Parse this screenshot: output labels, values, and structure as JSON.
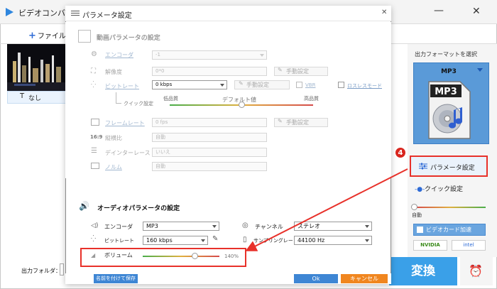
{
  "main": {
    "app_title": "ビデオコンバ",
    "add_file_label": "ファイル追",
    "subtitle_label": "なし",
    "output_folder_label": "出力フォルダ：",
    "convert_label": "変換"
  },
  "right_panel": {
    "output_format_label": "出力フォーマットを選択",
    "format_name": "MP3",
    "format_icon_text": "MP3",
    "param_settings_label": "パラメータ設定",
    "quick_settings_label": "クイック設定",
    "auto_label": "自動",
    "gpu_label": "ビデオカード加速",
    "nvidia_label": "NVIDIA",
    "intel_label": "intel"
  },
  "dialog": {
    "title": "パラメータ設定",
    "video": {
      "section_title": "動画パラメータの設定",
      "encoder_label": "エンコーダ",
      "encoder_value": "-1",
      "resolution_label": "解像度",
      "resolution_value": "0*0",
      "bitrate_label": "ビットレート",
      "bitrate_value": "0 kbps",
      "vbr_label": "VBR",
      "lossless_label": "ロスレスモード",
      "quality_low": "低品質",
      "quality_default": "デフォルト値",
      "quality_high": "高品質",
      "quick_setting_label": "クイック設定",
      "framerate_label": "フレームレート",
      "framerate_value": "0 fps",
      "aspect_label": "縦横比",
      "aspect_value": "自動",
      "deinterlace_label": "デインターレース",
      "deinterlace_value": "いいえ",
      "norm_label": "ノルム",
      "norm_value": "自動",
      "manual_label": "手動設定"
    },
    "audio": {
      "section_title": "オーディオパラメータの設定",
      "encoder_label": "エンコーダ",
      "encoder_value": "MP3",
      "channel_label": "チャンネル",
      "channel_value": "ステレオ",
      "bitrate_label": "ビットレート",
      "bitrate_value": "160 kbps",
      "samplerate_label": "サンプリングレート",
      "samplerate_value": "44100 Hz",
      "volume_label": "ボリューム",
      "volume_value": "140%",
      "volume_level_fraction": 0.7
    },
    "save_as_label": "名前を付けて保存",
    "ok_label": "Ok",
    "cancel_label": "キャンセル"
  },
  "step_badge": "4",
  "colors": {
    "accent_blue": "#3e86d4",
    "highlight_red": "#e8312a",
    "cancel_orange": "#f0861f",
    "convert_blue": "#3aa0e8"
  }
}
